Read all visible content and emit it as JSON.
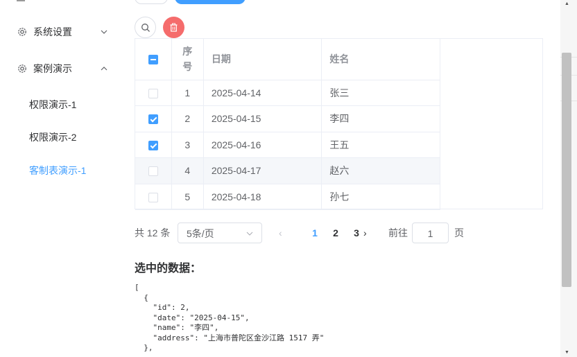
{
  "sidebar": {
    "menus": [
      {
        "label": "系统设置",
        "icon": "gear-icon",
        "expanded": false
      },
      {
        "label": "案例演示",
        "icon": "gear-icon",
        "expanded": true
      }
    ],
    "submenu": [
      {
        "label": "权限演示-1",
        "active": false
      },
      {
        "label": "权限演示-2",
        "active": false
      },
      {
        "label": "客制表演示-1",
        "active": true
      }
    ]
  },
  "toolbar": {
    "search_icon": "search-icon",
    "delete_icon": "trash-icon"
  },
  "table": {
    "headers": {
      "index": "序\n号",
      "date": "日期",
      "name": "姓名"
    },
    "rows": [
      {
        "index": "1",
        "date": "2025-04-14",
        "name": "张三",
        "checked": false
      },
      {
        "index": "2",
        "date": "2025-04-15",
        "name": "李四",
        "checked": true
      },
      {
        "index": "3",
        "date": "2025-04-16",
        "name": "王五",
        "checked": true
      },
      {
        "index": "4",
        "date": "2025-04-17",
        "name": "赵六",
        "checked": false
      },
      {
        "index": "5",
        "date": "2025-04-18",
        "name": "孙七",
        "checked": false
      }
    ]
  },
  "pagination": {
    "total": "共 12 条",
    "page_size": "5条/页",
    "pages": [
      "1",
      "2",
      "3"
    ],
    "current": "1",
    "goto_label": "前往",
    "goto_value": "1",
    "page_unit": "页"
  },
  "selection": {
    "title": "选中的数据：",
    "json_text": "[\n  {\n    \"id\": 2,\n    \"date\": \"2025-04-15\",\n    \"name\": \"李四\",\n    \"address\": \"上海市普陀区金沙江路 1517 弄\"\n  },"
  },
  "colors": {
    "accent": "#409eff",
    "danger": "#f56c6c"
  }
}
